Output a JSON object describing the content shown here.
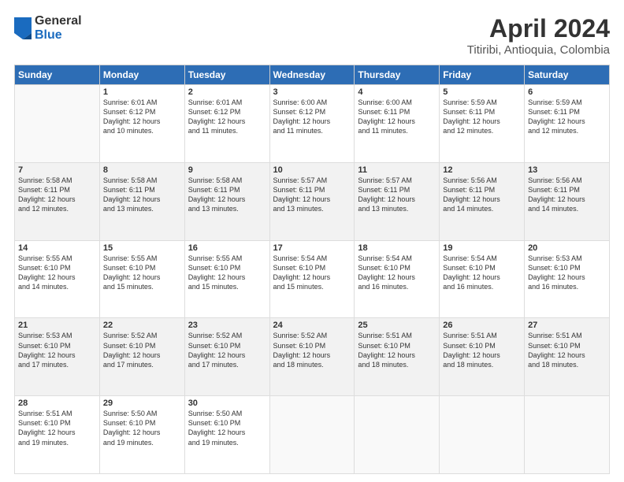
{
  "logo": {
    "general": "General",
    "blue": "Blue"
  },
  "title": "April 2024",
  "location": "Titiribi, Antioquia, Colombia",
  "days_of_week": [
    "Sunday",
    "Monday",
    "Tuesday",
    "Wednesday",
    "Thursday",
    "Friday",
    "Saturday"
  ],
  "weeks": [
    [
      {
        "day": "",
        "info": ""
      },
      {
        "day": "1",
        "info": "Sunrise: 6:01 AM\nSunset: 6:12 PM\nDaylight: 12 hours\nand 10 minutes."
      },
      {
        "day": "2",
        "info": "Sunrise: 6:01 AM\nSunset: 6:12 PM\nDaylight: 12 hours\nand 11 minutes."
      },
      {
        "day": "3",
        "info": "Sunrise: 6:00 AM\nSunset: 6:12 PM\nDaylight: 12 hours\nand 11 minutes."
      },
      {
        "day": "4",
        "info": "Sunrise: 6:00 AM\nSunset: 6:11 PM\nDaylight: 12 hours\nand 11 minutes."
      },
      {
        "day": "5",
        "info": "Sunrise: 5:59 AM\nSunset: 6:11 PM\nDaylight: 12 hours\nand 12 minutes."
      },
      {
        "day": "6",
        "info": "Sunrise: 5:59 AM\nSunset: 6:11 PM\nDaylight: 12 hours\nand 12 minutes."
      }
    ],
    [
      {
        "day": "7",
        "info": "Sunrise: 5:58 AM\nSunset: 6:11 PM\nDaylight: 12 hours\nand 12 minutes."
      },
      {
        "day": "8",
        "info": "Sunrise: 5:58 AM\nSunset: 6:11 PM\nDaylight: 12 hours\nand 13 minutes."
      },
      {
        "day": "9",
        "info": "Sunrise: 5:58 AM\nSunset: 6:11 PM\nDaylight: 12 hours\nand 13 minutes."
      },
      {
        "day": "10",
        "info": "Sunrise: 5:57 AM\nSunset: 6:11 PM\nDaylight: 12 hours\nand 13 minutes."
      },
      {
        "day": "11",
        "info": "Sunrise: 5:57 AM\nSunset: 6:11 PM\nDaylight: 12 hours\nand 13 minutes."
      },
      {
        "day": "12",
        "info": "Sunrise: 5:56 AM\nSunset: 6:11 PM\nDaylight: 12 hours\nand 14 minutes."
      },
      {
        "day": "13",
        "info": "Sunrise: 5:56 AM\nSunset: 6:11 PM\nDaylight: 12 hours\nand 14 minutes."
      }
    ],
    [
      {
        "day": "14",
        "info": "Sunrise: 5:55 AM\nSunset: 6:10 PM\nDaylight: 12 hours\nand 14 minutes."
      },
      {
        "day": "15",
        "info": "Sunrise: 5:55 AM\nSunset: 6:10 PM\nDaylight: 12 hours\nand 15 minutes."
      },
      {
        "day": "16",
        "info": "Sunrise: 5:55 AM\nSunset: 6:10 PM\nDaylight: 12 hours\nand 15 minutes."
      },
      {
        "day": "17",
        "info": "Sunrise: 5:54 AM\nSunset: 6:10 PM\nDaylight: 12 hours\nand 15 minutes."
      },
      {
        "day": "18",
        "info": "Sunrise: 5:54 AM\nSunset: 6:10 PM\nDaylight: 12 hours\nand 16 minutes."
      },
      {
        "day": "19",
        "info": "Sunrise: 5:54 AM\nSunset: 6:10 PM\nDaylight: 12 hours\nand 16 minutes."
      },
      {
        "day": "20",
        "info": "Sunrise: 5:53 AM\nSunset: 6:10 PM\nDaylight: 12 hours\nand 16 minutes."
      }
    ],
    [
      {
        "day": "21",
        "info": "Sunrise: 5:53 AM\nSunset: 6:10 PM\nDaylight: 12 hours\nand 17 minutes."
      },
      {
        "day": "22",
        "info": "Sunrise: 5:52 AM\nSunset: 6:10 PM\nDaylight: 12 hours\nand 17 minutes."
      },
      {
        "day": "23",
        "info": "Sunrise: 5:52 AM\nSunset: 6:10 PM\nDaylight: 12 hours\nand 17 minutes."
      },
      {
        "day": "24",
        "info": "Sunrise: 5:52 AM\nSunset: 6:10 PM\nDaylight: 12 hours\nand 18 minutes."
      },
      {
        "day": "25",
        "info": "Sunrise: 5:51 AM\nSunset: 6:10 PM\nDaylight: 12 hours\nand 18 minutes."
      },
      {
        "day": "26",
        "info": "Sunrise: 5:51 AM\nSunset: 6:10 PM\nDaylight: 12 hours\nand 18 minutes."
      },
      {
        "day": "27",
        "info": "Sunrise: 5:51 AM\nSunset: 6:10 PM\nDaylight: 12 hours\nand 18 minutes."
      }
    ],
    [
      {
        "day": "28",
        "info": "Sunrise: 5:51 AM\nSunset: 6:10 PM\nDaylight: 12 hours\nand 19 minutes."
      },
      {
        "day": "29",
        "info": "Sunrise: 5:50 AM\nSunset: 6:10 PM\nDaylight: 12 hours\nand 19 minutes."
      },
      {
        "day": "30",
        "info": "Sunrise: 5:50 AM\nSunset: 6:10 PM\nDaylight: 12 hours\nand 19 minutes."
      },
      {
        "day": "",
        "info": ""
      },
      {
        "day": "",
        "info": ""
      },
      {
        "day": "",
        "info": ""
      },
      {
        "day": "",
        "info": ""
      }
    ]
  ]
}
